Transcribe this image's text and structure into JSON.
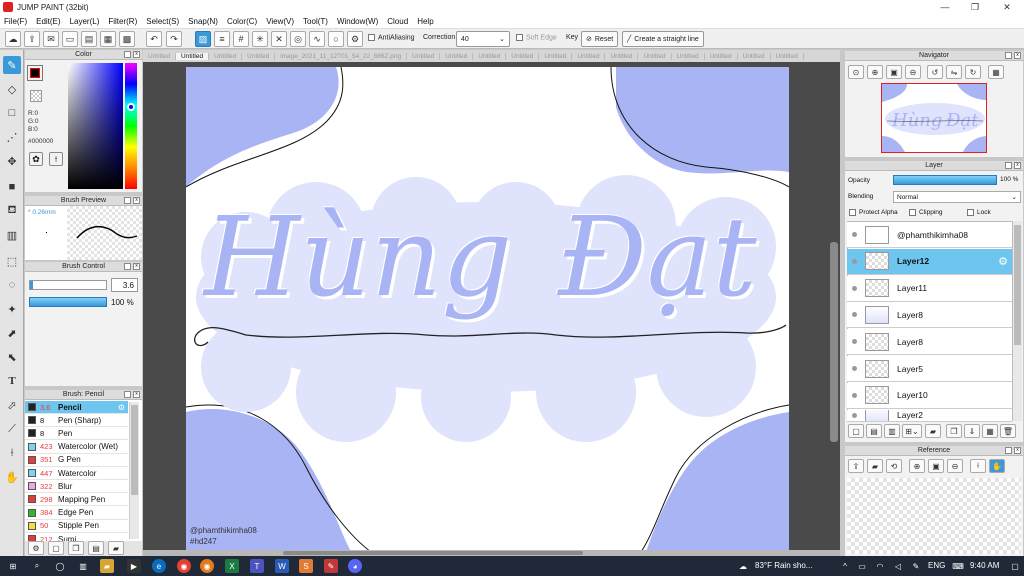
{
  "app": {
    "title": "JUMP PAINT (32bit)"
  },
  "menu": [
    "File(F)",
    "Edit(E)",
    "Layer(L)",
    "Filter(R)",
    "Select(S)",
    "Snap(N)",
    "Color(C)",
    "View(V)",
    "Tool(T)",
    "Window(W)",
    "Cloud",
    "Help"
  ],
  "toolbar": {
    "antialiasing": "AntiAliasing",
    "correction_label": "Correction",
    "correction_value": "40",
    "soft_edge": "Soft Edge",
    "key_label": "Key",
    "reset_label": "Reset",
    "straight_line_label": "Create a straight line"
  },
  "tabs": [
    "Untitled",
    "Untitled",
    "Untitled",
    "Untitled",
    "image_2021_11_12T01_54_22_886Z.png",
    "Untitled",
    "Untitled",
    "Untitled",
    "Untitled",
    "Untitled",
    "Untitled",
    "Untitled",
    "Untitled",
    "Untitled",
    "Untitled",
    "Untitled",
    "Untitled"
  ],
  "color_panel": {
    "title": "Color",
    "r": "R:0",
    "g": "G:0",
    "b": "B:0",
    "hex": "#000000",
    "current": "#000000"
  },
  "brush_preview": {
    "title": "Brush Preview",
    "size": "* 0.26mm"
  },
  "brush_control": {
    "title": "Brush Control",
    "size": "3.6",
    "opacity": "100 %"
  },
  "brush_list": {
    "title": "Brush: Pencil",
    "items": [
      {
        "size": "3.6",
        "name": "Pencil",
        "color": "#222222"
      },
      {
        "size": "8",
        "name": "Pen (Sharp)",
        "color": "#222222"
      },
      {
        "size": "8",
        "name": "Pen",
        "color": "#222222"
      },
      {
        "size": "423",
        "name": "Watercolor (Wet)",
        "color": "#7ad3f5"
      },
      {
        "size": "351",
        "name": "G Pen",
        "color": "#e63b3b"
      },
      {
        "size": "447",
        "name": "Watercolor",
        "color": "#7ad3f5"
      },
      {
        "size": "322",
        "name": "Blur",
        "color": "#f0a4e8"
      },
      {
        "size": "298",
        "name": "Mapping Pen",
        "color": "#e63b3b"
      },
      {
        "size": "384",
        "name": "Edge Pen",
        "color": "#2db82d"
      },
      {
        "size": "50",
        "name": "Stipple Pen",
        "color": "#f0e23b"
      },
      {
        "size": "212",
        "name": "Sumi",
        "color": "#e63b3b"
      }
    ]
  },
  "canvas": {
    "text1": "Hùng",
    "text2": "Đạt",
    "credit1": "@phamthikimha08",
    "credit2": "#hd247"
  },
  "navigator": {
    "title": "Navigator"
  },
  "layer_panel": {
    "title": "Layer",
    "opacity_label": "Opacity",
    "opacity_value": "100 %",
    "blending_label": "Blending",
    "blending_value": "Normal",
    "protect_alpha": "Protect Alpha",
    "clipping": "Clipping",
    "lock": "Lock",
    "layers": [
      "@phamthikimha08",
      "Layer12",
      "Layer11",
      "Layer8",
      "Layer8",
      "Layer5",
      "Layer10",
      "Layer2"
    ]
  },
  "reference": {
    "title": "Reference"
  },
  "taskbar": {
    "weather": "83°F  Rain sho...",
    "lang": "ENG",
    "time": "9:40 AM"
  },
  "colors": {
    "accent": "#3a9ad9",
    "lavender": "#a9b4f5",
    "lavender_light": "#dfe3fb",
    "selection": "#6ec6f0"
  }
}
